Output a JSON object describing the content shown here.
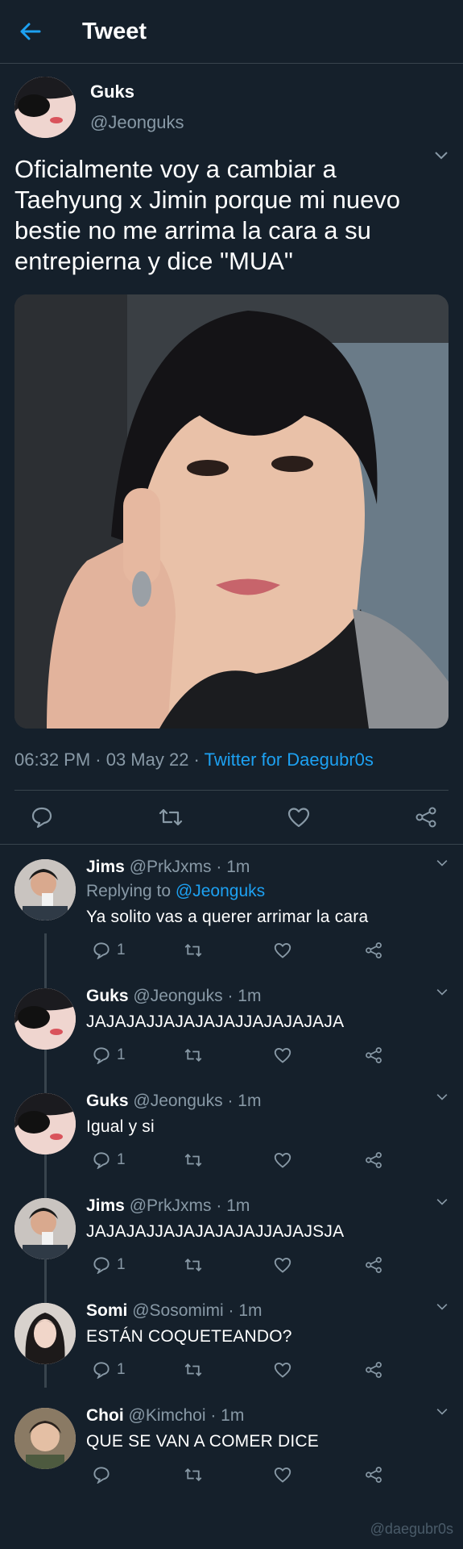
{
  "header": {
    "title": "Tweet"
  },
  "tweet": {
    "name": "Guks",
    "handle": "@Jeonguks",
    "text": "Oficialmente voy a cambiar a Taehyung x Jimin porque mi nuevo bestie no me arrima la cara a su entrepierna y dice \"MUA\"",
    "time": "06:32 PM · 03 May 22 · ",
    "via": "Twitter for Daegubr0s"
  },
  "replies": [
    {
      "name": "Jims",
      "handle": "@PrkJxms",
      "ago": "· 1m",
      "replying_prefix": "Replying to ",
      "replying_to": "@Jeonguks",
      "text": "Ya solito vas a querer arrimar la cara",
      "count": "1"
    },
    {
      "name": "Guks",
      "handle": "@Jeonguks",
      "ago": "· 1m",
      "text": "JAJAJAJJAJAJAJAJJAJAJAJAJA",
      "count": "1"
    },
    {
      "name": "Guks",
      "handle": "@Jeonguks",
      "ago": "· 1m",
      "text": "Igual y si",
      "count": "1"
    },
    {
      "name": "Jims",
      "handle": "@PrkJxms",
      "ago": "· 1m",
      "text": "JAJAJAJJAJAJAJAJAJJAJAJSJA",
      "count": "1"
    },
    {
      "name": "Somi",
      "handle": "@Sosomimi",
      "ago": "· 1m",
      "text": "ESTÁN COQUETEANDO?",
      "count": "1"
    },
    {
      "name": "Choi",
      "handle": "@Kimchoi",
      "ago": "· 1m",
      "text": "QUE SE VAN A COMER DICE",
      "count": ""
    }
  ],
  "watermark": "@daegubr0s",
  "colors": {
    "background": "#15202b",
    "accent": "#1da1f2",
    "secondary_text": "#8899a6",
    "divider": "#38444d"
  }
}
